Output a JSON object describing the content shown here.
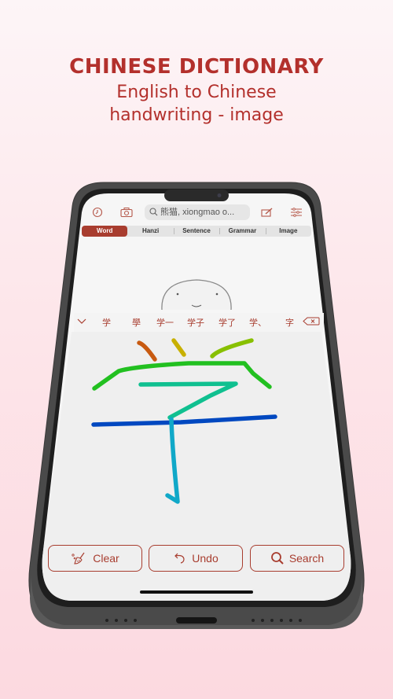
{
  "headline": {
    "title": "CHINESE DICTIONARY",
    "subtitle_line1": "English to Chinese",
    "subtitle_line2": "handwriting - image"
  },
  "colors": {
    "accent": "#a83d2f",
    "headline": "#b3302c",
    "background_top": "#fdf5f7",
    "background_bottom": "#fcd9e0"
  },
  "topbar": {
    "icons": [
      "history-icon",
      "camera-icon",
      "handwriting-icon",
      "settings-sliders-icon"
    ],
    "search_placeholder": "熊猫, xiongmao o..."
  },
  "tabs": [
    {
      "label": "Word",
      "active": true
    },
    {
      "label": "Hanzi",
      "active": false
    },
    {
      "label": "Sentence",
      "active": false
    },
    {
      "label": "Grammar",
      "active": false
    },
    {
      "label": "Image",
      "active": false
    }
  ],
  "candidates": [
    "学",
    "學",
    "学一",
    "学子",
    "学了",
    "学、",
    "字"
  ],
  "drawing": {
    "recognized_character": "学",
    "stroke_colors": [
      "#c85a10",
      "#c8b000",
      "#88c000",
      "#22c020",
      "#10c090",
      "#0048c0",
      "#10a8c8"
    ]
  },
  "buttons": {
    "clear": "Clear",
    "undo": "Undo",
    "search": "Search"
  }
}
